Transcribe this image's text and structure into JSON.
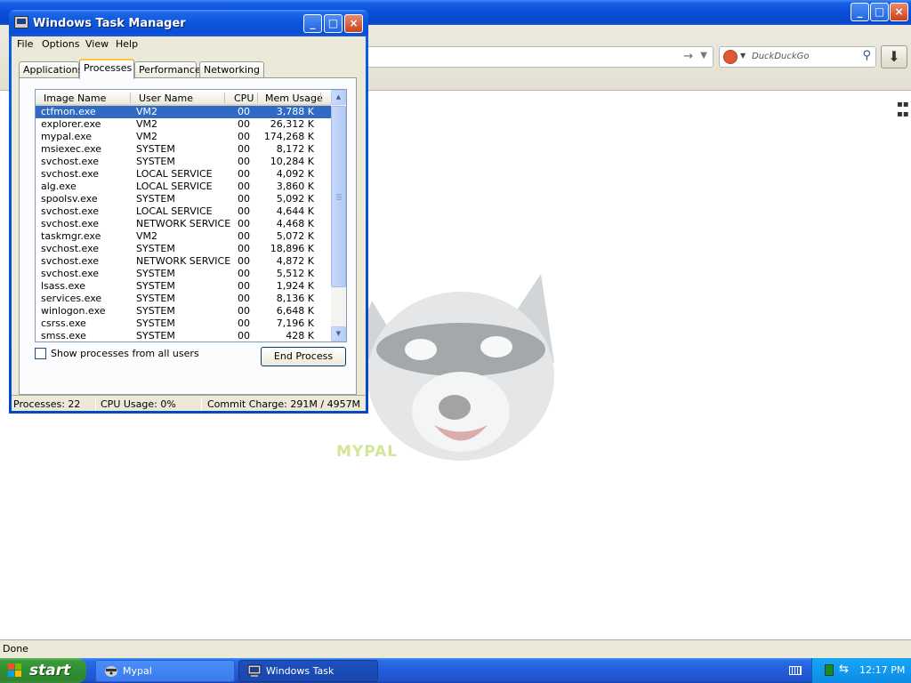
{
  "browser": {
    "search_placeholder": "DuckDuckGo",
    "watermark_text": "MYPAL",
    "status_text": "Done",
    "titlebar_buttons": {
      "minimize": "_",
      "maximize": "□",
      "close": "×"
    }
  },
  "task_manager": {
    "title": "Windows Task Manager",
    "menu": [
      "File",
      "Options",
      "View",
      "Help"
    ],
    "tabs": [
      "Applications",
      "Processes",
      "Performance",
      "Networking"
    ],
    "active_tab": "Processes",
    "columns": {
      "name": "Image Name",
      "user": "User Name",
      "cpu": "CPU",
      "mem": "Mem Usage"
    },
    "processes": [
      {
        "name": "ctfmon.exe",
        "user": "VM2",
        "cpu": "00",
        "mem": "3,788 K",
        "selected": true
      },
      {
        "name": "explorer.exe",
        "user": "VM2",
        "cpu": "00",
        "mem": "26,312 K"
      },
      {
        "name": "mypal.exe",
        "user": "VM2",
        "cpu": "00",
        "mem": "174,268 K"
      },
      {
        "name": "msiexec.exe",
        "user": "SYSTEM",
        "cpu": "00",
        "mem": "8,172 K"
      },
      {
        "name": "svchost.exe",
        "user": "SYSTEM",
        "cpu": "00",
        "mem": "10,284 K"
      },
      {
        "name": "svchost.exe",
        "user": "LOCAL SERVICE",
        "cpu": "00",
        "mem": "4,092 K"
      },
      {
        "name": "alg.exe",
        "user": "LOCAL SERVICE",
        "cpu": "00",
        "mem": "3,860 K"
      },
      {
        "name": "spoolsv.exe",
        "user": "SYSTEM",
        "cpu": "00",
        "mem": "5,092 K"
      },
      {
        "name": "svchost.exe",
        "user": "LOCAL SERVICE",
        "cpu": "00",
        "mem": "4,644 K"
      },
      {
        "name": "svchost.exe",
        "user": "NETWORK SERVICE",
        "cpu": "00",
        "mem": "4,468 K"
      },
      {
        "name": "taskmgr.exe",
        "user": "VM2",
        "cpu": "00",
        "mem": "5,072 K"
      },
      {
        "name": "svchost.exe",
        "user": "SYSTEM",
        "cpu": "00",
        "mem": "18,896 K"
      },
      {
        "name": "svchost.exe",
        "user": "NETWORK SERVICE",
        "cpu": "00",
        "mem": "4,872 K"
      },
      {
        "name": "svchost.exe",
        "user": "SYSTEM",
        "cpu": "00",
        "mem": "5,512 K"
      },
      {
        "name": "lsass.exe",
        "user": "SYSTEM",
        "cpu": "00",
        "mem": "1,924 K"
      },
      {
        "name": "services.exe",
        "user": "SYSTEM",
        "cpu": "00",
        "mem": "8,136 K"
      },
      {
        "name": "winlogon.exe",
        "user": "SYSTEM",
        "cpu": "00",
        "mem": "6,648 K"
      },
      {
        "name": "csrss.exe",
        "user": "SYSTEM",
        "cpu": "00",
        "mem": "7,196 K"
      },
      {
        "name": "smss.exe",
        "user": "SYSTEM",
        "cpu": "00",
        "mem": "428 K"
      }
    ],
    "show_all_label": "Show processes from all users",
    "show_all_checked": false,
    "end_process_label": "End Process",
    "status": {
      "processes": "Processes: 22",
      "cpu": "CPU Usage: 0%",
      "commit": "Commit Charge: 291M / 4957M"
    }
  },
  "taskbar": {
    "start_label": "start",
    "tasks": [
      {
        "label": "Mypal",
        "icon": "raccoon-icon",
        "active": false
      },
      {
        "label": "Windows Task Manager",
        "icon": "task-manager-icon",
        "active": true
      }
    ],
    "clock": "12:17 PM"
  },
  "colors": {
    "xp_blue": "#0a4ed8",
    "selection": "#316ac5",
    "start_green": "#308e30",
    "tray_blue": "#0f8be6"
  }
}
